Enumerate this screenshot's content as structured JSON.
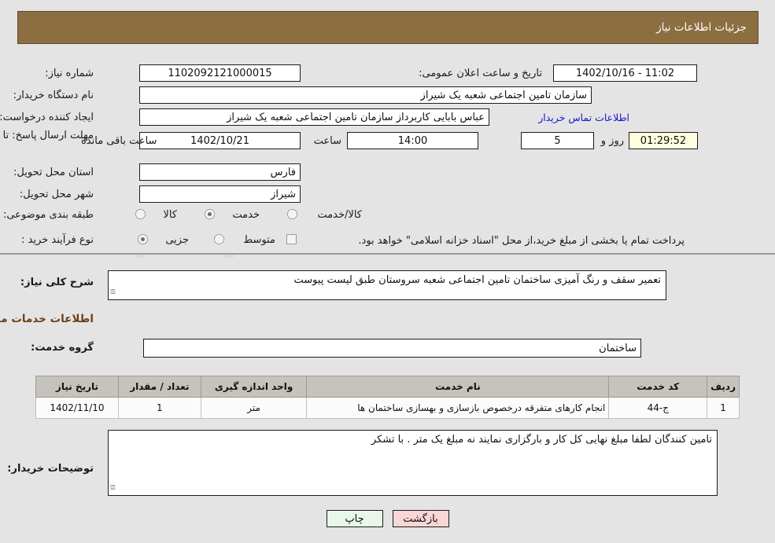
{
  "window": {
    "title": "جزئیات اطلاعات نیاز"
  },
  "watermark": {
    "text": "anaTender.net",
    "shield_icon": "shield-icon",
    "arrow_icon": "arrow-icon"
  },
  "need_info": {
    "need_number_label": "شماره نیاز:",
    "need_number_value": "1102092121000015",
    "announce_datetime_label": "تاریخ و ساعت اعلان عمومی:",
    "announce_datetime_value": "11:02 - 1402/10/16",
    "buyer_org_label": "نام دستگاه خریدار:",
    "buyer_org_value": "سازمان تامین اجتماعی شعبه یک شیراز",
    "requester_label": "ایجاد کننده درخواست:",
    "requester_value": "عباس  بابایی  کاربرداز  سازمان تامین اجتماعی شعبه یک شیراز",
    "buyer_contact_link": "اطلاعات تماس خریدار",
    "deadline_label": "مهلت ارسال پاسخ: تا تاریخ:",
    "deadline_date": "1402/10/21",
    "deadline_hour_label": "ساعت",
    "deadline_hour_value": "14:00",
    "remaining_days_value": "5",
    "remaining_days_label": "روز و",
    "remaining_time_value": "01:29:52",
    "remaining_time_label": "ساعت باقی مانده",
    "province_label": "استان محل تحویل:",
    "province_value": "فارس",
    "city_label": "شهر محل تحویل:",
    "city_value": "شیراز",
    "category_label": "طبقه بندی موضوعی:",
    "category_options": [
      {
        "label": "کالا",
        "selected": false
      },
      {
        "label": "خدمت",
        "selected": true
      },
      {
        "label": "کالا/خدمت",
        "selected": false
      }
    ],
    "process_label": "نوع فرآیند خرید :",
    "process_options": [
      {
        "label": "جزیی",
        "selected": true
      },
      {
        "label": "متوسط",
        "selected": false
      }
    ],
    "treasury_checkbox_checked": false,
    "treasury_text": "پرداخت تمام یا بخشی از مبلغ خرید،از محل \"اسناد خزانه اسلامی\" خواهد بود."
  },
  "general_description": {
    "label": "شرح کلی نیاز:",
    "value": "تعمیر سقف و رنگ آمیزی ساختمان تامین اجتماعی شعبه سروستان طبق لیست پیوست"
  },
  "services_section": {
    "heading": "اطلاعات خدمات مورد نیاز",
    "service_group_label": "گروه خدمت:",
    "service_group_value": "ساختمان"
  },
  "table": {
    "columns": [
      "ردیف",
      "کد خدمت",
      "نام خدمت",
      "واحد اندازه گیری",
      "تعداد / مقدار",
      "تاریخ نیاز"
    ],
    "rows": [
      {
        "row": "1",
        "code": "ج-44",
        "name": "انجام کارهای متفرقه درخصوص بازسازی و بهسازی ساختمان ها",
        "unit": "متر",
        "quantity": "1",
        "need_date": "1402/11/10"
      }
    ]
  },
  "buyer_notes": {
    "label": "توضیحات خریدار:",
    "value": "تامین کنندگان لطفا مبلغ نهایی کل کار و بارگزاری نمایند نه مبلغ یک متر . با تشکر"
  },
  "footer": {
    "print_label": "چاپ",
    "back_label": "بازگشت"
  },
  "colors": {
    "header_brown": "#8d6e41",
    "page_bg": "#e4e4e4",
    "link_blue": "#1414d2",
    "heading_brown": "#6b3f18",
    "table_header_gray": "#c6c3bc",
    "highlight_yellow": "#ffffe0",
    "print_btn_green": "#e9f7e9",
    "back_btn_pink": "#fad6d6"
  }
}
